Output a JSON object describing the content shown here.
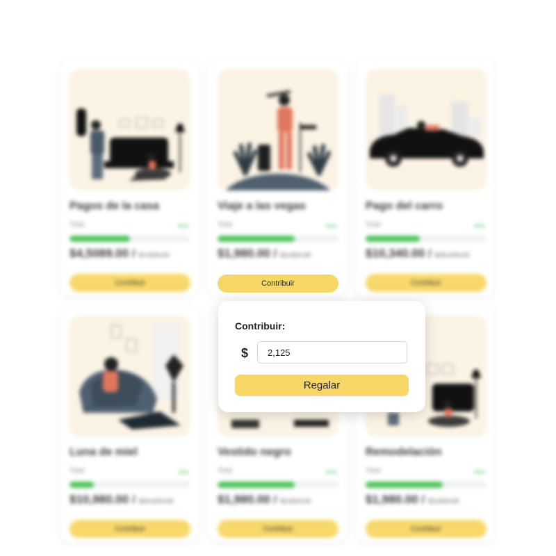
{
  "cards": [
    {
      "title": "Pagos de la casa",
      "total_label": "Total",
      "percent": "50%",
      "progress": 0.5,
      "raised": "$4,5089.00",
      "separator": "/",
      "goal": "$7,600.00",
      "button": "Contribuir"
    },
    {
      "title": "Viaje a las vegas",
      "total_label": "Total",
      "percent": "64%",
      "progress": 0.64,
      "raised": "$1,980.00",
      "separator": "/",
      "goal": "$2,800.00",
      "button": "Contribuir"
    },
    {
      "title": "Pago del carro",
      "total_label": "Total",
      "percent": "45%",
      "progress": 0.45,
      "raised": "$10,340.00",
      "separator": "/",
      "goal": "$25,000.00",
      "button": "Contribuir"
    },
    {
      "title": "Luna de miel",
      "total_label": "Total",
      "percent": "20%",
      "progress": 0.2,
      "raised": "$10,980.00",
      "separator": "/",
      "goal": "$60,000.00",
      "button": "Contribuir"
    },
    {
      "title": "Vestido negro",
      "total_label": "Total",
      "percent": "64%",
      "progress": 0.64,
      "raised": "$1,980.00",
      "separator": "/",
      "goal": "$2,800.00",
      "button": "Contribuir"
    },
    {
      "title": "Remodelación",
      "total_label": "Total",
      "percent": "64%",
      "progress": 0.64,
      "raised": "$1,980.00",
      "separator": "/",
      "goal": "$2,800.00",
      "button": "Contribuir"
    }
  ],
  "active_button": "Contribuir",
  "popover": {
    "title": "Contribuir:",
    "currency": "$",
    "amount": "2,125",
    "submit": "Regalar"
  },
  "colors": {
    "accent": "#f7d767",
    "progress": "#4ec25b",
    "art_background": "#fbf3e4"
  }
}
